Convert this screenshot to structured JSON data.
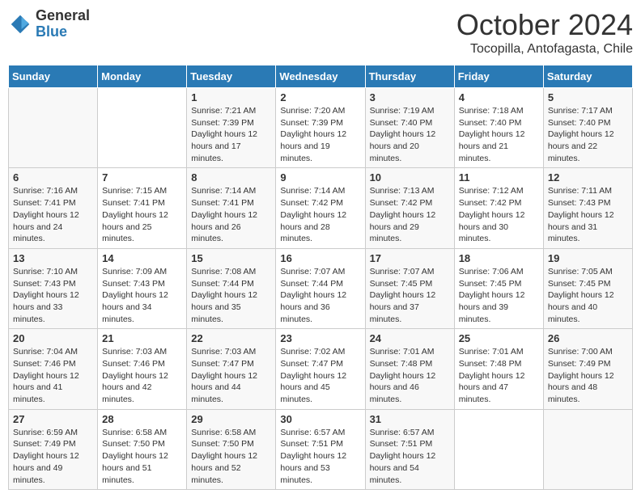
{
  "header": {
    "logo_general": "General",
    "logo_blue": "Blue",
    "month_title": "October 2024",
    "location": "Tocopilla, Antofagasta, Chile"
  },
  "days_of_week": [
    "Sunday",
    "Monday",
    "Tuesday",
    "Wednesday",
    "Thursday",
    "Friday",
    "Saturday"
  ],
  "weeks": [
    [
      {
        "day": "",
        "sunrise": "",
        "sunset": "",
        "daylight": ""
      },
      {
        "day": "",
        "sunrise": "",
        "sunset": "",
        "daylight": ""
      },
      {
        "day": "1",
        "sunrise": "Sunrise: 7:21 AM",
        "sunset": "Sunset: 7:39 PM",
        "daylight": "Daylight: 12 hours and 17 minutes."
      },
      {
        "day": "2",
        "sunrise": "Sunrise: 7:20 AM",
        "sunset": "Sunset: 7:39 PM",
        "daylight": "Daylight: 12 hours and 19 minutes."
      },
      {
        "day": "3",
        "sunrise": "Sunrise: 7:19 AM",
        "sunset": "Sunset: 7:40 PM",
        "daylight": "Daylight: 12 hours and 20 minutes."
      },
      {
        "day": "4",
        "sunrise": "Sunrise: 7:18 AM",
        "sunset": "Sunset: 7:40 PM",
        "daylight": "Daylight: 12 hours and 21 minutes."
      },
      {
        "day": "5",
        "sunrise": "Sunrise: 7:17 AM",
        "sunset": "Sunset: 7:40 PM",
        "daylight": "Daylight: 12 hours and 22 minutes."
      }
    ],
    [
      {
        "day": "6",
        "sunrise": "Sunrise: 7:16 AM",
        "sunset": "Sunset: 7:41 PM",
        "daylight": "Daylight: 12 hours and 24 minutes."
      },
      {
        "day": "7",
        "sunrise": "Sunrise: 7:15 AM",
        "sunset": "Sunset: 7:41 PM",
        "daylight": "Daylight: 12 hours and 25 minutes."
      },
      {
        "day": "8",
        "sunrise": "Sunrise: 7:14 AM",
        "sunset": "Sunset: 7:41 PM",
        "daylight": "Daylight: 12 hours and 26 minutes."
      },
      {
        "day": "9",
        "sunrise": "Sunrise: 7:14 AM",
        "sunset": "Sunset: 7:42 PM",
        "daylight": "Daylight: 12 hours and 28 minutes."
      },
      {
        "day": "10",
        "sunrise": "Sunrise: 7:13 AM",
        "sunset": "Sunset: 7:42 PM",
        "daylight": "Daylight: 12 hours and 29 minutes."
      },
      {
        "day": "11",
        "sunrise": "Sunrise: 7:12 AM",
        "sunset": "Sunset: 7:42 PM",
        "daylight": "Daylight: 12 hours and 30 minutes."
      },
      {
        "day": "12",
        "sunrise": "Sunrise: 7:11 AM",
        "sunset": "Sunset: 7:43 PM",
        "daylight": "Daylight: 12 hours and 31 minutes."
      }
    ],
    [
      {
        "day": "13",
        "sunrise": "Sunrise: 7:10 AM",
        "sunset": "Sunset: 7:43 PM",
        "daylight": "Daylight: 12 hours and 33 minutes."
      },
      {
        "day": "14",
        "sunrise": "Sunrise: 7:09 AM",
        "sunset": "Sunset: 7:43 PM",
        "daylight": "Daylight: 12 hours and 34 minutes."
      },
      {
        "day": "15",
        "sunrise": "Sunrise: 7:08 AM",
        "sunset": "Sunset: 7:44 PM",
        "daylight": "Daylight: 12 hours and 35 minutes."
      },
      {
        "day": "16",
        "sunrise": "Sunrise: 7:07 AM",
        "sunset": "Sunset: 7:44 PM",
        "daylight": "Daylight: 12 hours and 36 minutes."
      },
      {
        "day": "17",
        "sunrise": "Sunrise: 7:07 AM",
        "sunset": "Sunset: 7:45 PM",
        "daylight": "Daylight: 12 hours and 37 minutes."
      },
      {
        "day": "18",
        "sunrise": "Sunrise: 7:06 AM",
        "sunset": "Sunset: 7:45 PM",
        "daylight": "Daylight: 12 hours and 39 minutes."
      },
      {
        "day": "19",
        "sunrise": "Sunrise: 7:05 AM",
        "sunset": "Sunset: 7:45 PM",
        "daylight": "Daylight: 12 hours and 40 minutes."
      }
    ],
    [
      {
        "day": "20",
        "sunrise": "Sunrise: 7:04 AM",
        "sunset": "Sunset: 7:46 PM",
        "daylight": "Daylight: 12 hours and 41 minutes."
      },
      {
        "day": "21",
        "sunrise": "Sunrise: 7:03 AM",
        "sunset": "Sunset: 7:46 PM",
        "daylight": "Daylight: 12 hours and 42 minutes."
      },
      {
        "day": "22",
        "sunrise": "Sunrise: 7:03 AM",
        "sunset": "Sunset: 7:47 PM",
        "daylight": "Daylight: 12 hours and 44 minutes."
      },
      {
        "day": "23",
        "sunrise": "Sunrise: 7:02 AM",
        "sunset": "Sunset: 7:47 PM",
        "daylight": "Daylight: 12 hours and 45 minutes."
      },
      {
        "day": "24",
        "sunrise": "Sunrise: 7:01 AM",
        "sunset": "Sunset: 7:48 PM",
        "daylight": "Daylight: 12 hours and 46 minutes."
      },
      {
        "day": "25",
        "sunrise": "Sunrise: 7:01 AM",
        "sunset": "Sunset: 7:48 PM",
        "daylight": "Daylight: 12 hours and 47 minutes."
      },
      {
        "day": "26",
        "sunrise": "Sunrise: 7:00 AM",
        "sunset": "Sunset: 7:49 PM",
        "daylight": "Daylight: 12 hours and 48 minutes."
      }
    ],
    [
      {
        "day": "27",
        "sunrise": "Sunrise: 6:59 AM",
        "sunset": "Sunset: 7:49 PM",
        "daylight": "Daylight: 12 hours and 49 minutes."
      },
      {
        "day": "28",
        "sunrise": "Sunrise: 6:58 AM",
        "sunset": "Sunset: 7:50 PM",
        "daylight": "Daylight: 12 hours and 51 minutes."
      },
      {
        "day": "29",
        "sunrise": "Sunrise: 6:58 AM",
        "sunset": "Sunset: 7:50 PM",
        "daylight": "Daylight: 12 hours and 52 minutes."
      },
      {
        "day": "30",
        "sunrise": "Sunrise: 6:57 AM",
        "sunset": "Sunset: 7:51 PM",
        "daylight": "Daylight: 12 hours and 53 minutes."
      },
      {
        "day": "31",
        "sunrise": "Sunrise: 6:57 AM",
        "sunset": "Sunset: 7:51 PM",
        "daylight": "Daylight: 12 hours and 54 minutes."
      },
      {
        "day": "",
        "sunrise": "",
        "sunset": "",
        "daylight": ""
      },
      {
        "day": "",
        "sunrise": "",
        "sunset": "",
        "daylight": ""
      }
    ]
  ]
}
